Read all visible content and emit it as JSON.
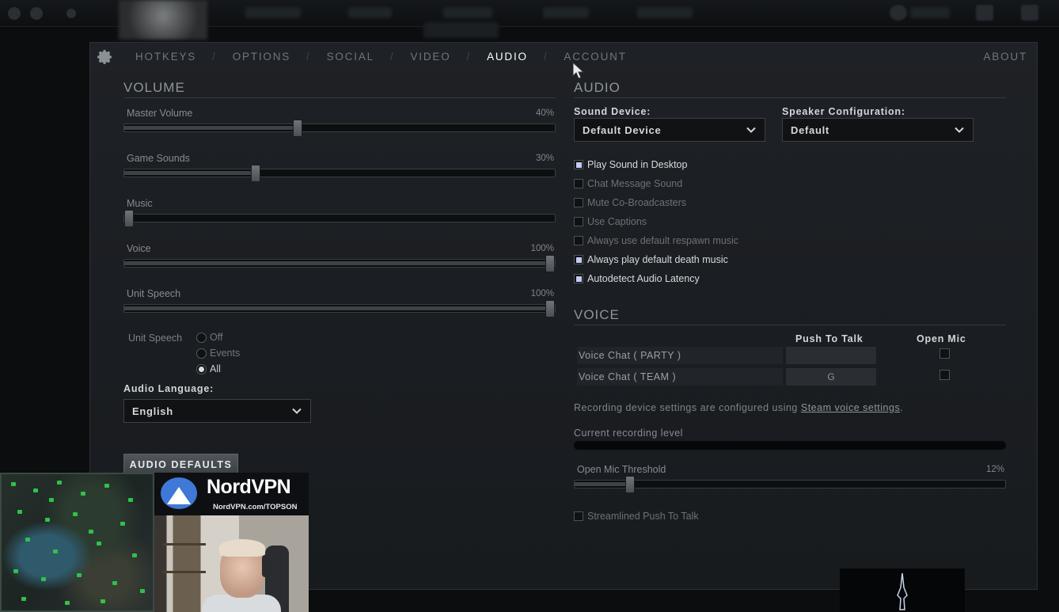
{
  "nav": {
    "tabs": [
      "HOTKEYS",
      "OPTIONS",
      "SOCIAL",
      "VIDEO",
      "AUDIO",
      "ACCOUNT"
    ],
    "active": "AUDIO",
    "about": "ABOUT"
  },
  "volume": {
    "title": "VOLUME",
    "sliders": [
      {
        "label": "Master Volume",
        "value_text": "40%",
        "value": 0.4
      },
      {
        "label": "Game Sounds",
        "value_text": "30%",
        "value": 0.3
      },
      {
        "label": "Music",
        "value_text": "",
        "value": 0.0
      },
      {
        "label": "Voice",
        "value_text": "100%",
        "value": 1.0
      },
      {
        "label": "Unit Speech",
        "value_text": "100%",
        "value": 1.0
      }
    ]
  },
  "unit_speech": {
    "label": "Unit Speech",
    "options": [
      "Off",
      "Events",
      "All"
    ],
    "selected": "All"
  },
  "audio_language": {
    "label": "Audio Language:",
    "value": "English"
  },
  "audio_defaults_button": "AUDIO DEFAULTS",
  "audio": {
    "title": "AUDIO",
    "sound_device": {
      "label": "Sound Device:",
      "value": "Default Device"
    },
    "speaker_config": {
      "label": "Speaker Configuration:",
      "value": "Default"
    },
    "checkboxes": [
      {
        "label": "Play Sound in Desktop",
        "checked": true
      },
      {
        "label": "Chat Message Sound",
        "checked": false
      },
      {
        "label": "Mute Co-Broadcasters",
        "checked": false
      },
      {
        "label": "Use Captions",
        "checked": false
      },
      {
        "label": "Always use default respawn music",
        "checked": false
      },
      {
        "label": "Always play default death music",
        "checked": true
      },
      {
        "label": "Autodetect Audio Latency",
        "checked": true
      }
    ]
  },
  "voice": {
    "title": "VOICE",
    "col_push": "Push To Talk",
    "col_open": "Open Mic",
    "rows": [
      {
        "label": "Voice Chat ( PARTY )",
        "key": ""
      },
      {
        "label": "Voice Chat ( TEAM )",
        "key": "G"
      }
    ],
    "info_prefix": "Recording device settings are configured using ",
    "info_link": "Steam voice settings",
    "info_suffix": ".",
    "recording_level_label": "Current recording level",
    "threshold": {
      "label": "Open Mic Threshold",
      "value_text": "12%",
      "value": 0.12
    },
    "streamlined": {
      "label": "Streamlined Push To Talk",
      "checked": false
    }
  },
  "overlay": {
    "brand": "NordVPN",
    "url": "NordVPN.com/TOPSON"
  },
  "colors": {
    "panel_bg": "#1c1f23",
    "active_tab": "#ffffff",
    "checkbox_on": "#c4cbf2",
    "nord_blue": "#3f78d6"
  }
}
